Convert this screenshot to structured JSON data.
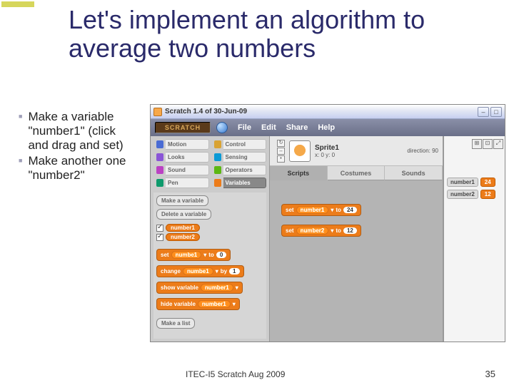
{
  "slide": {
    "title": "Let's implement an algorithm to average two numbers",
    "bullets": [
      "Make a variable \"number1\" (click and drag and set)",
      "Make another one \"number2\""
    ],
    "footer_center": "ITEC-I5 Scratch Aug 2009",
    "page": "35"
  },
  "scratch": {
    "window_title": "Scratch 1.4 of 30-Jun-09",
    "brand": "SCRATCH",
    "menus": [
      "File",
      "Edit",
      "Share",
      "Help"
    ],
    "categories": [
      {
        "name": "Motion",
        "color": "#4a6cd4"
      },
      {
        "name": "Control",
        "color": "#d9a334"
      },
      {
        "name": "Looks",
        "color": "#8a55d7"
      },
      {
        "name": "Sensing",
        "color": "#0b9ad6"
      },
      {
        "name": "Sound",
        "color": "#bb42c3"
      },
      {
        "name": "Operators",
        "color": "#5cb712"
      },
      {
        "name": "Pen",
        "color": "#0e9a6c"
      },
      {
        "name": "Variables",
        "color": "#ec7c1a",
        "selected": true
      }
    ],
    "var_buttons": {
      "make": "Make a variable",
      "delete": "Delete a variable",
      "make_list": "Make a list"
    },
    "variables": [
      {
        "name": "number1",
        "checked": true
      },
      {
        "name": "number2",
        "checked": true
      }
    ],
    "palette_blocks": {
      "set": {
        "label_set": "set",
        "target": "numbe1",
        "label_to": "to",
        "value": "0"
      },
      "change": {
        "label_change": "change",
        "target": "numbe1",
        "label_by": "by",
        "value": "1"
      },
      "show": {
        "label": "show variable",
        "target": "number1"
      },
      "hide": {
        "label": "hide variable",
        "target": "number1"
      }
    },
    "sprite": {
      "name": "Sprite1",
      "xy": "x: 0   y: 0",
      "dir": "direction: 90"
    },
    "tabs": [
      "Scripts",
      "Costumes",
      "Sounds"
    ],
    "script_blocks": [
      {
        "set": "set",
        "target": "number1",
        "to": "to",
        "value": "24"
      },
      {
        "set": "set",
        "target": "number2",
        "to": "to",
        "value": "12"
      }
    ],
    "monitors": [
      {
        "name": "number1",
        "value": "24"
      },
      {
        "name": "number2",
        "value": "12"
      }
    ]
  }
}
